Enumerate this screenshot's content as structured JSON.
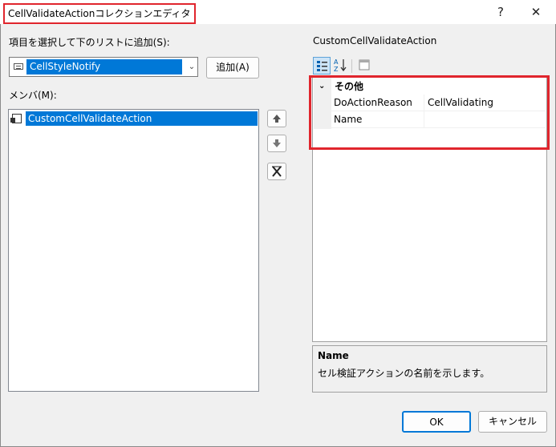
{
  "window": {
    "title": "CellValidateActionコレクションエディタ",
    "help_glyph": "?",
    "close_glyph": "✕"
  },
  "left": {
    "select_label": "項目を選択して下のリストに追加(S):",
    "combo_value": "CellStyleNotify",
    "add_button": "追加(A)",
    "members_label": "メンバ(M):",
    "members": [
      "CustomCellValidateAction"
    ]
  },
  "move_buttons": {
    "up_icon": "arrow-up-icon",
    "down_icon": "arrow-down-icon",
    "remove_icon": "remove-icon"
  },
  "right": {
    "object_title": "CustomCellValidateAction",
    "category": "その他",
    "properties": [
      {
        "name": "DoActionReason",
        "value": "CellValidating"
      },
      {
        "name": "Name",
        "value": ""
      }
    ],
    "description_title": "Name",
    "description_text": "セル検証アクションの名前を示します。"
  },
  "footer": {
    "ok": "OK",
    "cancel": "キャンセル"
  },
  "colors": {
    "highlight": "#e0252d",
    "selection": "#0078d7"
  }
}
